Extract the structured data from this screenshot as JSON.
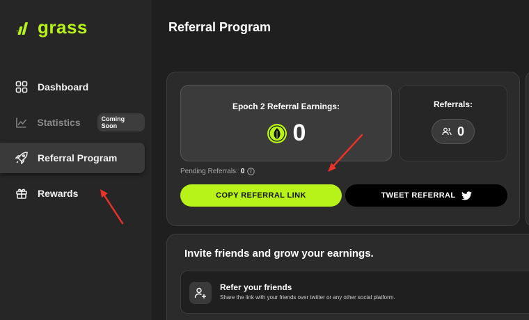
{
  "brand": {
    "name": "grass",
    "accent": "#b7f218"
  },
  "sidebar": {
    "items": [
      {
        "label": "Dashboard",
        "icon": "grid-icon"
      },
      {
        "label": "Statistics",
        "icon": "chart-icon",
        "badge": "Coming Soon"
      },
      {
        "label": "Referral Program",
        "icon": "rocket-icon"
      },
      {
        "label": "Rewards",
        "icon": "gift-icon"
      }
    ]
  },
  "main": {
    "title": "Referral Program",
    "earnings": {
      "label": "Epoch 2 Referral Earnings:",
      "value": "0",
      "icon": "leaf-coin-icon"
    },
    "referrals": {
      "label": "Referrals:",
      "value": "0",
      "icon": "users-icon"
    },
    "pending": {
      "label": "Pending Referrals:",
      "value": "0",
      "icon": "info-icon"
    },
    "copy_button": "COPY REFERRAL LINK",
    "tweet_button": "TWEET REFERRAL",
    "tweet_icon": "twitter-icon",
    "invite": {
      "title": "Invite friends and grow your earnings.",
      "step_title": "Refer your friends",
      "step_desc": "Share the link with your friends over twitter or any other social platform.",
      "step_icon": "add-user-icon"
    }
  }
}
